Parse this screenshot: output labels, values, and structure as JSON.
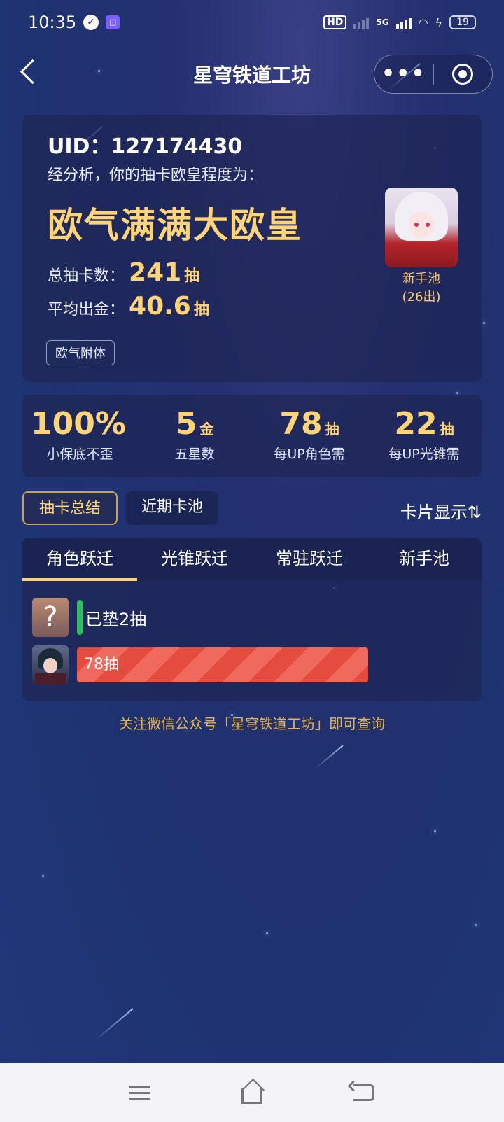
{
  "status_bar": {
    "time": "10:35",
    "network": "5G",
    "hd_label": "HD",
    "battery": "19"
  },
  "nav": {
    "title": "星穹铁道工坊",
    "more": "•••"
  },
  "summary": {
    "uid": "UID：127174430",
    "analysis_text": "经分析，你的抽卡欧皇程度为：",
    "verdict": "欧气满满大欧皇",
    "total_label": "总抽卡数：",
    "total_value": "241",
    "total_unit": "抽",
    "avg_label": "平均出金：",
    "avg_value": "40.6",
    "avg_unit": "抽",
    "tag": "欧气附体",
    "newbie_pool_name": "新手池",
    "newbie_pool_sub": "(26出)"
  },
  "stats": [
    {
      "value": "100%",
      "unit": "",
      "label": "小保底不歪"
    },
    {
      "value": "5",
      "unit": "金",
      "label": "五星数"
    },
    {
      "value": "78",
      "unit": "抽",
      "label": "每UP角色需"
    },
    {
      "value": "22",
      "unit": "抽",
      "label": "每UP光锥需"
    }
  ],
  "tabs": {
    "summary": "抽卡总结",
    "recent": "近期卡池",
    "card_display": "卡片显示⇅"
  },
  "pool_tabs": [
    "角色跃迁",
    "光锥跃迁",
    "常驻跃迁",
    "新手池"
  ],
  "pulls": {
    "padded": "已垫2抽",
    "unknown_icon": "?",
    "pull2": "78抽",
    "pull2_value": 78,
    "pull_bar_max": 90
  },
  "footer": "关注微信公众号「星穹铁道工坊」即可查询"
}
